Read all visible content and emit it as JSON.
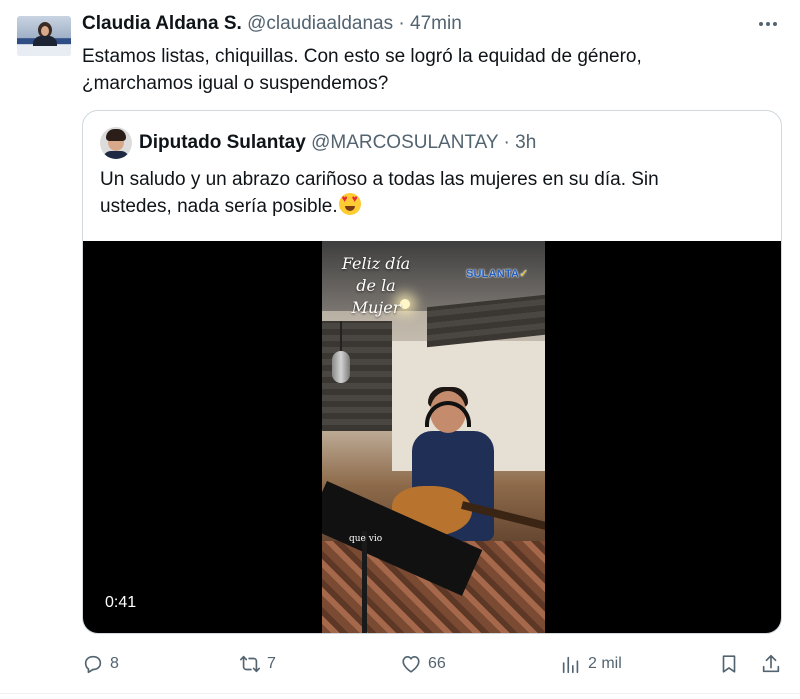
{
  "tweet": {
    "author_name": "Claudia Aldana S.",
    "author_handle": "@claudiaaldanas",
    "separator": "·",
    "time": "47min",
    "text_line1": "Estamos listas, chiquillas. Con esto se logró la equidad de género,",
    "text_line2": "¿marchamos igual o suspendemos?"
  },
  "quoted": {
    "author_name": "Diputado Sulantay",
    "author_handle": "@MARCOSULANTAY",
    "separator": "·",
    "time": "3h",
    "text_line1": "Un saludo y un abrazo cariñoso a todas las mujeres en su día. Sin",
    "text_line2": "ustedes, nada sería posible.",
    "emoji_icon": "heart-eyes-emoji",
    "video": {
      "greeting_line1": "Feliz día",
      "greeting_line2": "de la",
      "greeting_line3": "Mujer",
      "logo_text": "SULANTA",
      "caption": "que vio",
      "duration": "0:41"
    }
  },
  "actions": {
    "reply_count": "8",
    "retweet_count": "7",
    "like_count": "66",
    "views_count": "2 mil"
  },
  "icons": {
    "more": "more-horizontal-icon",
    "reply": "reply-icon",
    "retweet": "retweet-icon",
    "like": "heart-icon",
    "views": "views-icon",
    "bookmark": "bookmark-icon",
    "share": "share-icon"
  },
  "colors": {
    "text": "#0f1419",
    "muted": "#536471",
    "border": "#cfd9de"
  }
}
